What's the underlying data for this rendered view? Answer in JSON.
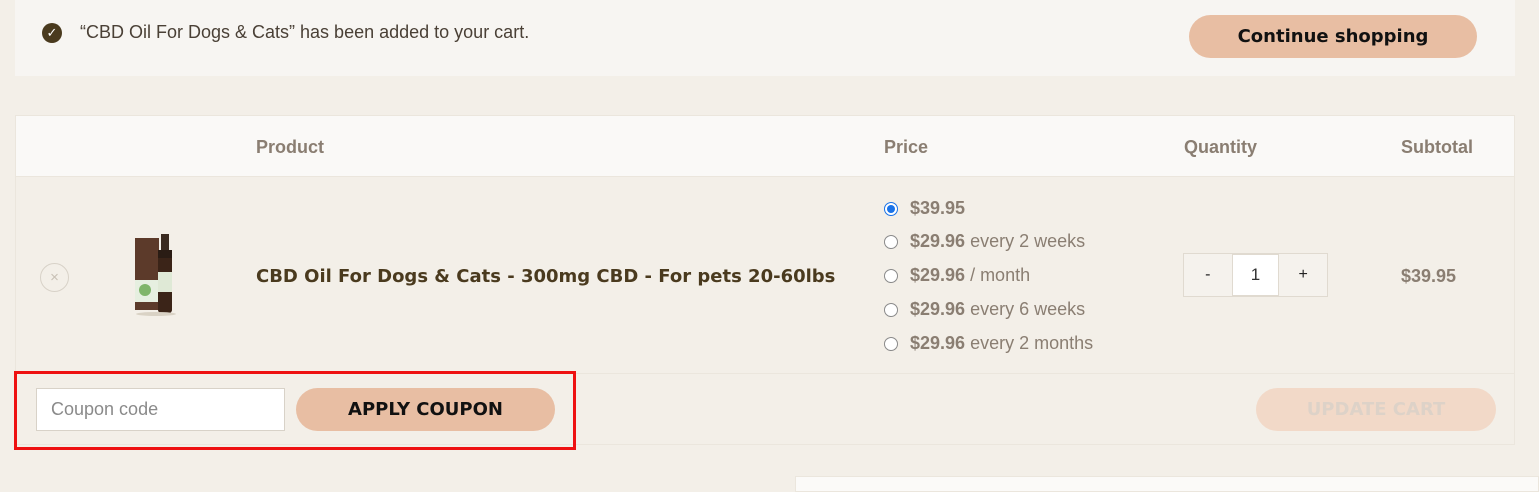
{
  "notice": {
    "message": "“CBD Oil For Dogs & Cats” has been added to your cart.",
    "continue_label": "Continue shopping"
  },
  "table": {
    "headers": {
      "product": "Product",
      "price": "Price",
      "quantity": "Quantity",
      "subtotal": "Subtotal"
    }
  },
  "item": {
    "remove_symbol": "×",
    "name": "CBD Oil For Dogs & Cats - 300mg CBD - For pets 20-60lbs",
    "price_options": [
      {
        "amount": "$39.95",
        "period": "",
        "selected": true
      },
      {
        "amount": "$29.96",
        "period": "every 2 weeks",
        "selected": false
      },
      {
        "amount": "$29.96",
        "period": "/ month",
        "selected": false
      },
      {
        "amount": "$29.96",
        "period": "every 6 weeks",
        "selected": false
      },
      {
        "amount": "$29.96",
        "period": "every 2 months",
        "selected": false
      }
    ],
    "qty_minus": "-",
    "quantity": "1",
    "qty_plus": "+",
    "subtotal": "$39.95"
  },
  "coupon": {
    "placeholder": "Coupon code",
    "apply_label": "APPLY COUPON"
  },
  "update_label": "UPDATE CART",
  "colors": {
    "accent_button": "#e8bea3",
    "highlight_border": "#ee1111",
    "radio_selected": "#1a73e8"
  }
}
